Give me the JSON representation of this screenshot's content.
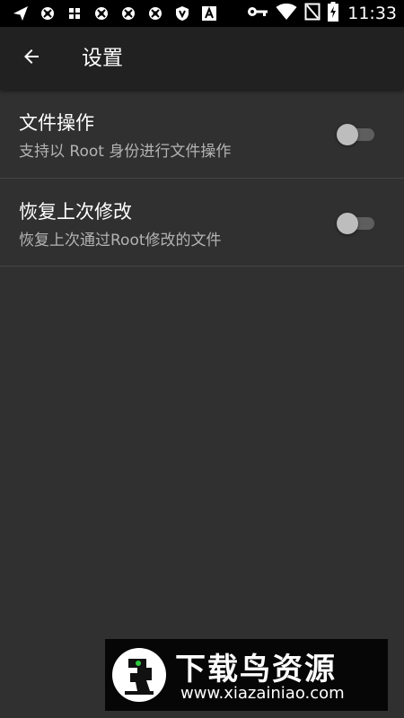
{
  "status_bar": {
    "time": "11:33",
    "left_icons": [
      "send-icon",
      "notification-icon",
      "grid-icon",
      "notification-icon",
      "notification-icon",
      "notification-icon",
      "vpn-shield-icon",
      "app-a-icon"
    ],
    "right_icons": [
      "key-icon",
      "wifi-icon",
      "no-sim-icon",
      "battery-charging-icon"
    ]
  },
  "app_bar": {
    "back_icon": "arrow-back-icon",
    "title": "设置"
  },
  "settings": [
    {
      "title": "文件操作",
      "description": "支持以 Root 身份进行文件操作",
      "enabled": false
    },
    {
      "title": "恢复上次修改",
      "description": "恢复上次通过Root修改的文件",
      "enabled": false
    }
  ],
  "watermark": {
    "brand": "下载鸟资源",
    "url": "www.xiazainiao.com"
  },
  "colors": {
    "background": "#303030",
    "app_bar": "#212121",
    "status_bar": "#000000",
    "divider": "#454545",
    "switch_thumb_off": "#bdbdbd",
    "switch_track_off": "#5e5e5e",
    "primary_text": "#ffffff",
    "secondary_text": "#b3b3b3"
  }
}
